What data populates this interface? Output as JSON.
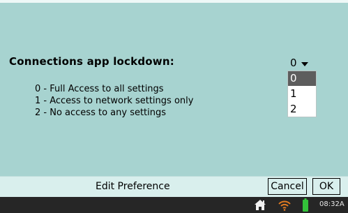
{
  "preference": {
    "title": "Connections app lockdown:",
    "options_help": [
      "0 - Full Access to all settings",
      "1 - Access to network settings only",
      "2 - No access to any settings"
    ]
  },
  "select": {
    "value": "0",
    "options": [
      "0",
      "1",
      "2"
    ],
    "highlighted_option": "0"
  },
  "button_bar": {
    "title": "Edit Preference",
    "cancel_label": "Cancel",
    "ok_label": "OK"
  },
  "status_bar": {
    "clock": "08:32A",
    "icons": [
      "home-icon",
      "wifi-icon",
      "battery-icon"
    ]
  },
  "colors": {
    "background": "#a7d3d0",
    "button_bar": "#d9efed",
    "status_bar": "#262626",
    "selected_option": "#5d5d5d",
    "wifi": "#e07a22",
    "battery": "#33c23a"
  }
}
